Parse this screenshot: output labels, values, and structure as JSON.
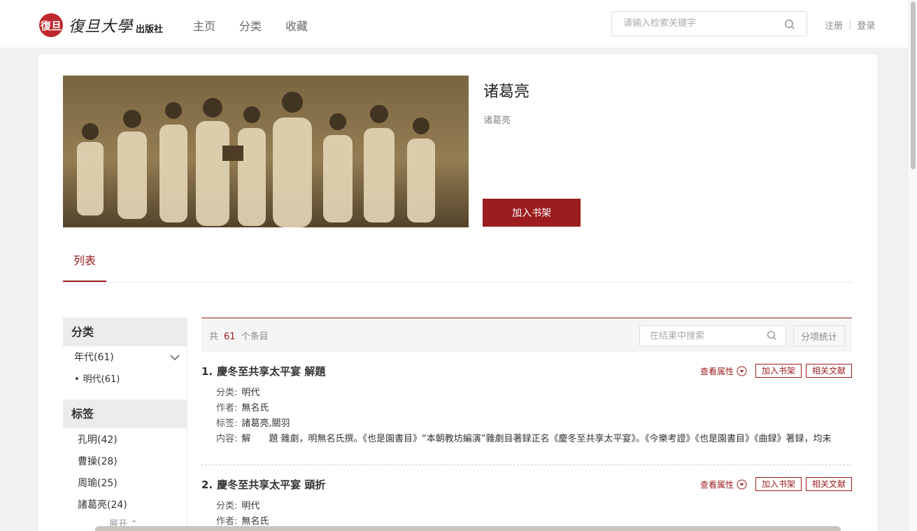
{
  "header": {
    "logo_mark": "復旦",
    "logo_script": "復旦大學",
    "logo_sub": "出版社",
    "nav": [
      "主页",
      "分类",
      "收藏"
    ],
    "search_placeholder": "请输入检索关键字",
    "register": "注册",
    "login": "登录"
  },
  "detail": {
    "title": "诸葛亮",
    "subtitle": "诸葛亮",
    "add_shelf": "加入书架"
  },
  "tabs": {
    "active": "列表"
  },
  "sidebar": {
    "category_head": "分类",
    "year_label": "年代(61)",
    "year_sub": "明代(61)",
    "tag_head": "标签",
    "tags": [
      "孔明(42)",
      "曹操(28)",
      "周瑜(25)",
      "諸葛亮(24)"
    ],
    "expand": "展开"
  },
  "list": {
    "count_prefix": "共",
    "count": "61",
    "count_suffix": "个条目",
    "search_placeholder": "在结果中搜索",
    "stats_button": "分项统计",
    "view_props": "查看属性",
    "add_shelf": "加入书架",
    "related": "相关文献",
    "labels": {
      "category": "分类:",
      "author": "作者:",
      "tags": "标签:",
      "content": "内容:"
    },
    "entries": [
      {
        "index": "1.",
        "title": "慶冬至共享太平宴  解題",
        "category": "明代",
        "author": "無名氏",
        "tags": "諸葛亮,關羽",
        "content": "解　　題  雜劇，明無名氏撰。《也是園書目》“本朝教坊編演”雜劇目著録正名《慶冬至共享太平宴》。《今樂考證》《也是園書目》《曲録》著録，均未"
      },
      {
        "index": "2.",
        "title": "慶冬至共享太平宴  頭折",
        "category": "明代",
        "author": "無名氏"
      }
    ]
  }
}
